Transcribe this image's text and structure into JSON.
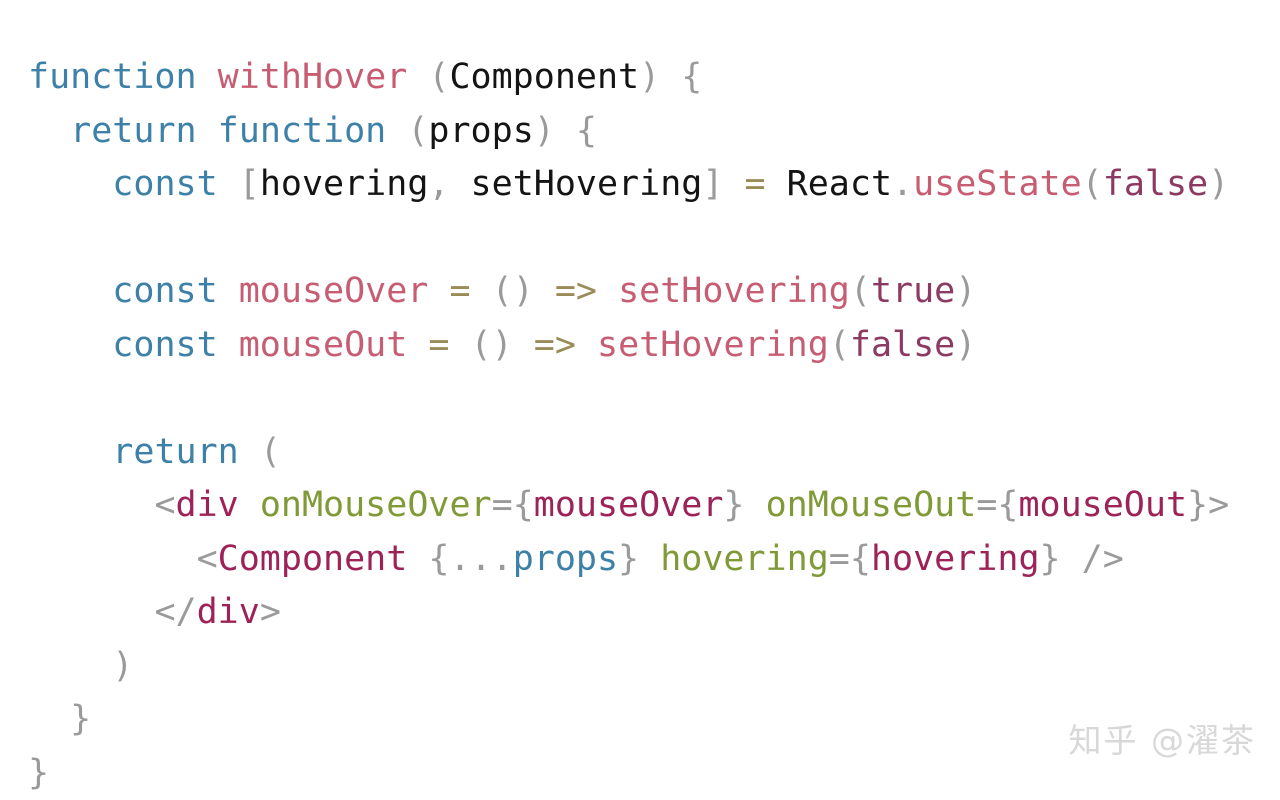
{
  "snippet": {
    "language": "jsx",
    "title": "withHover higher-order component",
    "background_color": "#ffffff",
    "palette": {
      "keyword": "#3d80a8",
      "function_name": "#c75d72",
      "plain": "#141414",
      "punctuation": "#9a9a9a",
      "operator": "#9a8c58",
      "constant": "#8d3a63",
      "jsx_tag": "#9c2257",
      "jsx_attribute": "#7f9a37",
      "jsx_value": "#9c2257",
      "prop": "#3d80a8",
      "watermark": "#d8d8d8"
    },
    "plain_text": "function withHover (Component) {\n  return function (props) {\n    const [hovering, setHovering] = React.useState(false)\n\n    const mouseOver = () => setHovering(true)\n    const mouseOut = () => setHovering(false)\n\n    return (\n      <div onMouseOver={mouseOver} onMouseOut={mouseOut}>\n        <Component {...props} hovering={hovering} />\n      </div>\n    )\n  }\n}",
    "lines": [
      {
        "n": 1,
        "indent": 0,
        "tokens": [
          {
            "t": "function",
            "c": "t-kw"
          },
          {
            "t": " ",
            "c": "t-plain"
          },
          {
            "t": "withHover",
            "c": "t-fnname"
          },
          {
            "t": " ",
            "c": "t-plain"
          },
          {
            "t": "(",
            "c": "t-punc"
          },
          {
            "t": "Component",
            "c": "t-plain"
          },
          {
            "t": ")",
            "c": "t-punc"
          },
          {
            "t": " ",
            "c": "t-plain"
          },
          {
            "t": "{",
            "c": "t-punc"
          }
        ]
      },
      {
        "n": 2,
        "indent": 2,
        "tokens": [
          {
            "t": "return",
            "c": "t-kw"
          },
          {
            "t": " ",
            "c": "t-plain"
          },
          {
            "t": "function",
            "c": "t-kw"
          },
          {
            "t": " ",
            "c": "t-plain"
          },
          {
            "t": "(",
            "c": "t-punc"
          },
          {
            "t": "props",
            "c": "t-plain"
          },
          {
            "t": ")",
            "c": "t-punc"
          },
          {
            "t": " ",
            "c": "t-plain"
          },
          {
            "t": "{",
            "c": "t-punc"
          }
        ]
      },
      {
        "n": 3,
        "indent": 4,
        "tokens": [
          {
            "t": "const",
            "c": "t-kw"
          },
          {
            "t": " ",
            "c": "t-plain"
          },
          {
            "t": "[",
            "c": "t-punc"
          },
          {
            "t": "hovering",
            "c": "t-plain"
          },
          {
            "t": ",",
            "c": "t-punc"
          },
          {
            "t": " ",
            "c": "t-plain"
          },
          {
            "t": "setHovering",
            "c": "t-plain"
          },
          {
            "t": "]",
            "c": "t-punc"
          },
          {
            "t": " ",
            "c": "t-plain"
          },
          {
            "t": "=",
            "c": "t-op"
          },
          {
            "t": " ",
            "c": "t-plain"
          },
          {
            "t": "React",
            "c": "t-plain"
          },
          {
            "t": ".",
            "c": "t-punc"
          },
          {
            "t": "useState",
            "c": "t-fnname"
          },
          {
            "t": "(",
            "c": "t-punc"
          },
          {
            "t": "false",
            "c": "t-const"
          },
          {
            "t": ")",
            "c": "t-punc"
          }
        ]
      },
      {
        "n": 4,
        "indent": 0,
        "tokens": []
      },
      {
        "n": 5,
        "indent": 4,
        "tokens": [
          {
            "t": "const",
            "c": "t-kw"
          },
          {
            "t": " ",
            "c": "t-plain"
          },
          {
            "t": "mouseOver",
            "c": "t-fnname"
          },
          {
            "t": " ",
            "c": "t-plain"
          },
          {
            "t": "=",
            "c": "t-op"
          },
          {
            "t": " ",
            "c": "t-plain"
          },
          {
            "t": "(",
            "c": "t-punc"
          },
          {
            "t": ")",
            "c": "t-punc"
          },
          {
            "t": " ",
            "c": "t-plain"
          },
          {
            "t": "=>",
            "c": "t-op"
          },
          {
            "t": " ",
            "c": "t-plain"
          },
          {
            "t": "setHovering",
            "c": "t-fnname"
          },
          {
            "t": "(",
            "c": "t-punc"
          },
          {
            "t": "true",
            "c": "t-const"
          },
          {
            "t": ")",
            "c": "t-punc"
          }
        ]
      },
      {
        "n": 6,
        "indent": 4,
        "tokens": [
          {
            "t": "const",
            "c": "t-kw"
          },
          {
            "t": " ",
            "c": "t-plain"
          },
          {
            "t": "mouseOut",
            "c": "t-fnname"
          },
          {
            "t": " ",
            "c": "t-plain"
          },
          {
            "t": "=",
            "c": "t-op"
          },
          {
            "t": " ",
            "c": "t-plain"
          },
          {
            "t": "(",
            "c": "t-punc"
          },
          {
            "t": ")",
            "c": "t-punc"
          },
          {
            "t": " ",
            "c": "t-plain"
          },
          {
            "t": "=>",
            "c": "t-op"
          },
          {
            "t": " ",
            "c": "t-plain"
          },
          {
            "t": "setHovering",
            "c": "t-fnname"
          },
          {
            "t": "(",
            "c": "t-punc"
          },
          {
            "t": "false",
            "c": "t-const"
          },
          {
            "t": ")",
            "c": "t-punc"
          }
        ]
      },
      {
        "n": 7,
        "indent": 0,
        "tokens": []
      },
      {
        "n": 8,
        "indent": 4,
        "tokens": [
          {
            "t": "return",
            "c": "t-kw"
          },
          {
            "t": " ",
            "c": "t-plain"
          },
          {
            "t": "(",
            "c": "t-punc"
          }
        ]
      },
      {
        "n": 9,
        "indent": 6,
        "tokens": [
          {
            "t": "<",
            "c": "t-punc"
          },
          {
            "t": "div",
            "c": "t-tag"
          },
          {
            "t": " ",
            "c": "t-plain"
          },
          {
            "t": "onMouseOver",
            "c": "t-attr"
          },
          {
            "t": "=",
            "c": "t-punc"
          },
          {
            "t": "{",
            "c": "t-punc"
          },
          {
            "t": "mouseOver",
            "c": "t-jsxval"
          },
          {
            "t": "}",
            "c": "t-punc"
          },
          {
            "t": " ",
            "c": "t-plain"
          },
          {
            "t": "onMouseOut",
            "c": "t-attr"
          },
          {
            "t": "=",
            "c": "t-punc"
          },
          {
            "t": "{",
            "c": "t-punc"
          },
          {
            "t": "mouseOut",
            "c": "t-jsxval"
          },
          {
            "t": "}",
            "c": "t-punc"
          },
          {
            "t": ">",
            "c": "t-punc"
          }
        ]
      },
      {
        "n": 10,
        "indent": 8,
        "tokens": [
          {
            "t": "<",
            "c": "t-punc"
          },
          {
            "t": "Component",
            "c": "t-tag"
          },
          {
            "t": " ",
            "c": "t-plain"
          },
          {
            "t": "{",
            "c": "t-punc"
          },
          {
            "t": "...",
            "c": "t-punc"
          },
          {
            "t": "props",
            "c": "t-prop"
          },
          {
            "t": "}",
            "c": "t-punc"
          },
          {
            "t": " ",
            "c": "t-plain"
          },
          {
            "t": "hovering",
            "c": "t-attr"
          },
          {
            "t": "=",
            "c": "t-punc"
          },
          {
            "t": "{",
            "c": "t-punc"
          },
          {
            "t": "hovering",
            "c": "t-jsxval"
          },
          {
            "t": "}",
            "c": "t-punc"
          },
          {
            "t": " ",
            "c": "t-plain"
          },
          {
            "t": "/>",
            "c": "t-punc"
          }
        ]
      },
      {
        "n": 11,
        "indent": 6,
        "tokens": [
          {
            "t": "</",
            "c": "t-punc"
          },
          {
            "t": "div",
            "c": "t-tag"
          },
          {
            "t": ">",
            "c": "t-punc"
          }
        ]
      },
      {
        "n": 12,
        "indent": 4,
        "tokens": [
          {
            "t": ")",
            "c": "t-punc"
          }
        ]
      },
      {
        "n": 13,
        "indent": 2,
        "tokens": [
          {
            "t": "}",
            "c": "t-punc"
          }
        ]
      },
      {
        "n": 14,
        "indent": 0,
        "tokens": [
          {
            "t": "}",
            "c": "t-punc"
          }
        ]
      }
    ]
  },
  "watermark": {
    "text": "知乎 @濯茶",
    "site": "知乎",
    "handle": "@濯茶"
  }
}
